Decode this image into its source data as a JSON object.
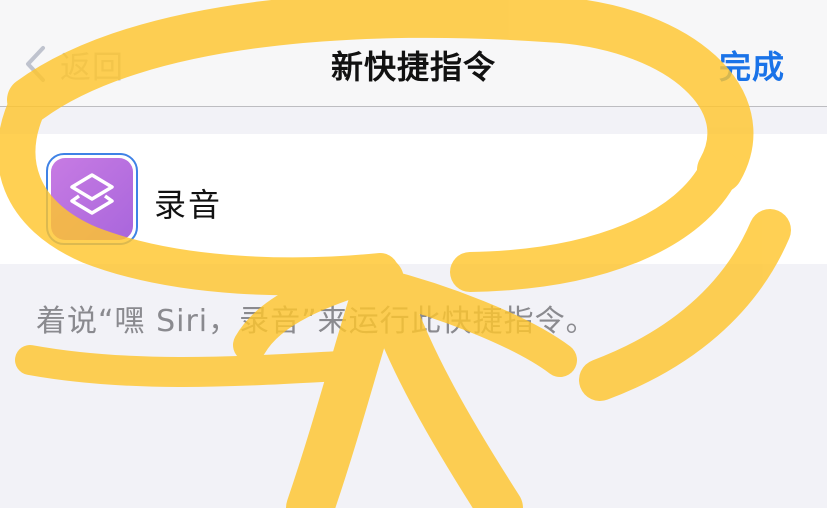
{
  "navbar": {
    "back_label": "返回",
    "title": "新快捷指令",
    "done_label": "完成"
  },
  "shortcut": {
    "name": "录音"
  },
  "hint": {
    "text": "着说“嘿 Siri，录音”来运行此快捷指令。"
  },
  "colors": {
    "accent": "#1a73e8",
    "icon_purple": "#b36fe0",
    "highlight": "#ffc62e"
  },
  "icons": {
    "back": "chevron-left-icon",
    "app": "shortcuts-layers-icon"
  }
}
